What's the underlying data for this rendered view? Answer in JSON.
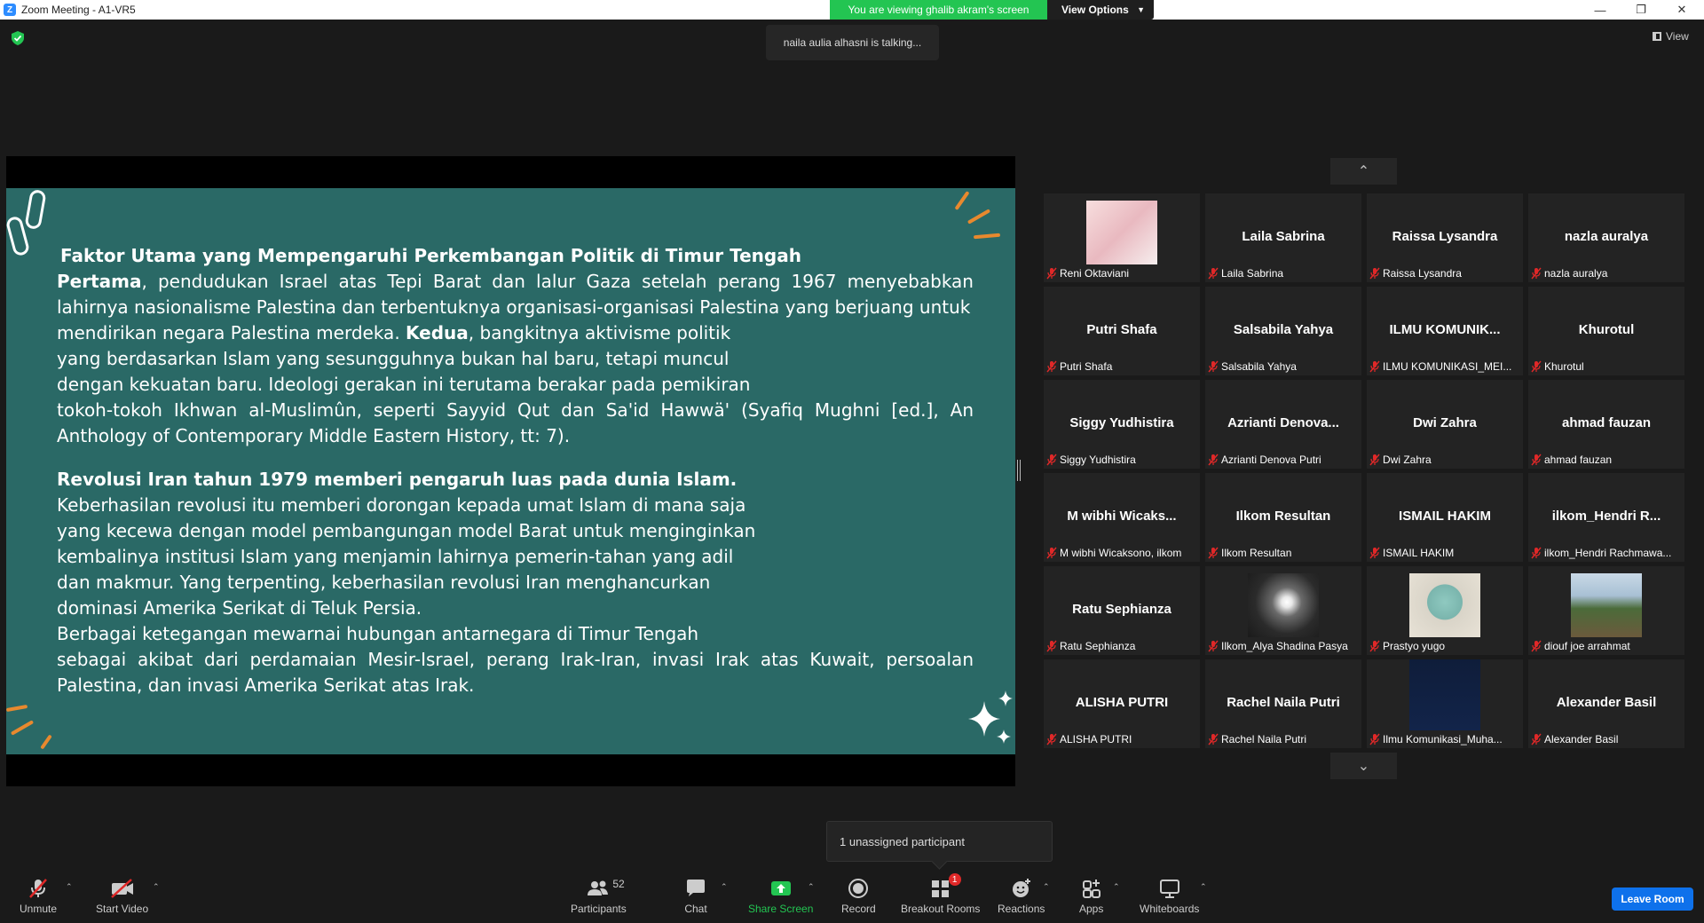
{
  "window": {
    "title": "Zoom Meeting - A1-VR5",
    "share_banner": "You are viewing ghalib akram's screen",
    "view_options": "View Options"
  },
  "talking_indicator": "naila aulia alhasni is talking...",
  "view_label": "View",
  "slide": {
    "heading": "Faktor Utama yang Mempengaruhi Perkembangan Politik di Timur Tengah",
    "p1_bold": "Pertama",
    "p1_line1": ", pendudukan Israel atas Tepi Barat dan lalur Gaza setelah perang 1967 menyebabkan",
    "p1_line2": "lahirnya nasionalisme Palestina dan terbentuknya organisasi-organisasi Palestina yang berjuang untuk",
    "p1_line3a": "mendirikan negara Palestina merdeka. ",
    "p1_line3_bold": "Kedua",
    "p1_line3b": ", bangkitnya aktivisme politik",
    "p1_line4": "yang berdasarkan Islam yang sesungguhnya bukan hal baru, tetapi muncul",
    "p1_line5": "dengan kekuatan baru. Ideologi gerakan ini terutama berakar pada pemikiran",
    "p1_line6": "tokoh-tokoh Ikhwan al-Muslimûn, seperti Sayyid Qut dan Sa'id Hawwä' (Syafiq Mughni [ed.], An",
    "p1_line7": "Anthology of Contemporary Middle Eastern History, tt: 7).",
    "p2_heading": "Revolusi Iran tahun 1979 memberi pengaruh luas pada dunia Islam.",
    "p2_line1": "Keberhasilan revolusi itu memberi dorongan kepada umat Islam di mana saja",
    "p2_line2": "yang kecewa dengan model pembangungan model Barat untuk menginginkan",
    "p2_line3": "kembalinya institusi Islam yang menjamin lahirnya pemerin-tahan yang adil",
    "p2_line4": "dan makmur. Yang terpenting, keberhasilan revolusi Iran menghancurkan",
    "p2_line5": "dominasi Amerika Serikat di Teluk Persia.",
    "p2_line6": "Berbagai ketegangan mewarnai hubungan antarnegara di Timur Tengah",
    "p2_line7": "sebagai akibat dari perdamaian Mesir-Israel, perang Irak-Iran, invasi Irak atas Kuwait, persoalan",
    "p2_line8": "Palestina, dan invasi Amerika Serikat atas Irak."
  },
  "gallery": {
    "tiles": [
      {
        "big": "",
        "label": "Reni Oktaviani",
        "thumb": "pink"
      },
      {
        "big": "Laila  Sabrina",
        "label": "Laila  Sabrina"
      },
      {
        "big": "Raissa Lysandra",
        "label": "Raissa Lysandra"
      },
      {
        "big": "nazla auralya",
        "label": "nazla auralya"
      },
      {
        "big": "Putri Shafa",
        "label": "Putri Shafa"
      },
      {
        "big": "Salsabila Yahya",
        "label": "Salsabila Yahya"
      },
      {
        "big": "ILMU  KOMUNIK...",
        "label": "ILMU KOMUNIKASI_MEI..."
      },
      {
        "big": "Khurotul",
        "label": "Khurotul"
      },
      {
        "big": "Siggy Yudhistira",
        "label": "Siggy Yudhistira"
      },
      {
        "big": "Azrianti  Denova...",
        "label": "Azrianti Denova Putri"
      },
      {
        "big": "Dwi Zahra",
        "label": "Dwi Zahra"
      },
      {
        "big": "ahmad fauzan",
        "label": "ahmad fauzan"
      },
      {
        "big": "M  wibhi  Wicaks...",
        "label": "M wibhi Wicaksono, ilkom"
      },
      {
        "big": "Ilkom Resultan",
        "label": "Ilkom Resultan"
      },
      {
        "big": "ISMAIL HAKIM",
        "label": "ISMAIL HAKIM"
      },
      {
        "big": "ilkom_Hendri  R...",
        "label": "ilkom_Hendri Rachmawa..."
      },
      {
        "big": "Ratu Sephianza",
        "label": "Ratu Sephianza"
      },
      {
        "big": "",
        "label": "Ilkom_Alya Shadina Pasya",
        "thumb": "light"
      },
      {
        "big": "",
        "label": "Prastyo yugo",
        "thumb": "cartoon"
      },
      {
        "big": "",
        "label": "diouf joe arrahmat",
        "thumb": "outdoor"
      },
      {
        "big": "ALISHA PUTRI",
        "label": "ALISHA PUTRI"
      },
      {
        "big": "Rachel Naila Putri",
        "label": "Rachel Naila Putri"
      },
      {
        "big": "",
        "label": "Ilmu Komunikasi_Muha...",
        "thumb": "dark"
      },
      {
        "big": "Alexander Basil",
        "label": "Alexander Basil"
      }
    ]
  },
  "popup": "1 unassigned participant",
  "toolbar": {
    "unmute": "Unmute",
    "start_video": "Start Video",
    "participants": "Participants",
    "participants_count": "52",
    "chat": "Chat",
    "share_screen": "Share Screen",
    "record": "Record",
    "breakout_rooms": "Breakout Rooms",
    "breakout_badge": "1",
    "reactions": "Reactions",
    "apps": "Apps",
    "whiteboards": "Whiteboards",
    "leave": "Leave Room"
  },
  "colors": {
    "slide_bg": "#2a6966",
    "share_green": "#23c552",
    "leave_blue": "#0e71eb",
    "mute_red": "#e02828"
  }
}
